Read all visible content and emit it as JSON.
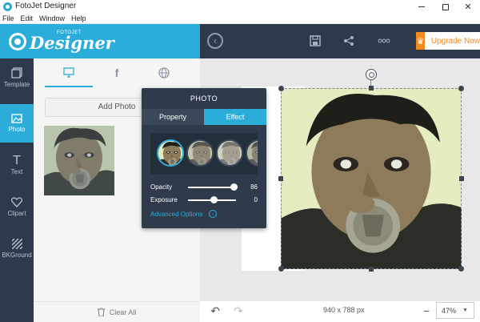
{
  "window": {
    "title": "FotoJet Designer",
    "min_icon": "minimize-icon",
    "max_icon": "maximize-icon",
    "close_icon": "close-icon"
  },
  "menu": {
    "items": [
      "File",
      "Edit",
      "Window",
      "Help"
    ]
  },
  "header": {
    "logo_top": "FOTOJET",
    "logo_main": "Designer",
    "upgrade_label": "Upgrade Now",
    "accent": "#2cacd9",
    "upgrade_color": "#f28a1c"
  },
  "sidebar": {
    "items": [
      {
        "label": "Template",
        "icon": "template-icon"
      },
      {
        "label": "Photo",
        "icon": "photo-icon"
      },
      {
        "label": "Text",
        "icon": "text-icon"
      },
      {
        "label": "Clipart",
        "icon": "heart-icon"
      },
      {
        "label": "BKGround",
        "icon": "background-icon"
      }
    ],
    "active": "Photo"
  },
  "photo_panel": {
    "tabs": [
      "computer-icon",
      "facebook-icon",
      "web-icon"
    ],
    "add_photo_label": "Add Photo",
    "clear_all_label": "Clear All"
  },
  "popover": {
    "title": "PHOTO",
    "tabs": {
      "property": "Property",
      "effect": "Effect"
    },
    "opacity": {
      "label": "Opacity",
      "value": "86"
    },
    "exposure": {
      "label": "Exposure",
      "value": "0"
    },
    "advanced_label": "Advanced Options"
  },
  "canvas": {
    "dimensions": "940 x 788 px",
    "zoom": "47%"
  }
}
